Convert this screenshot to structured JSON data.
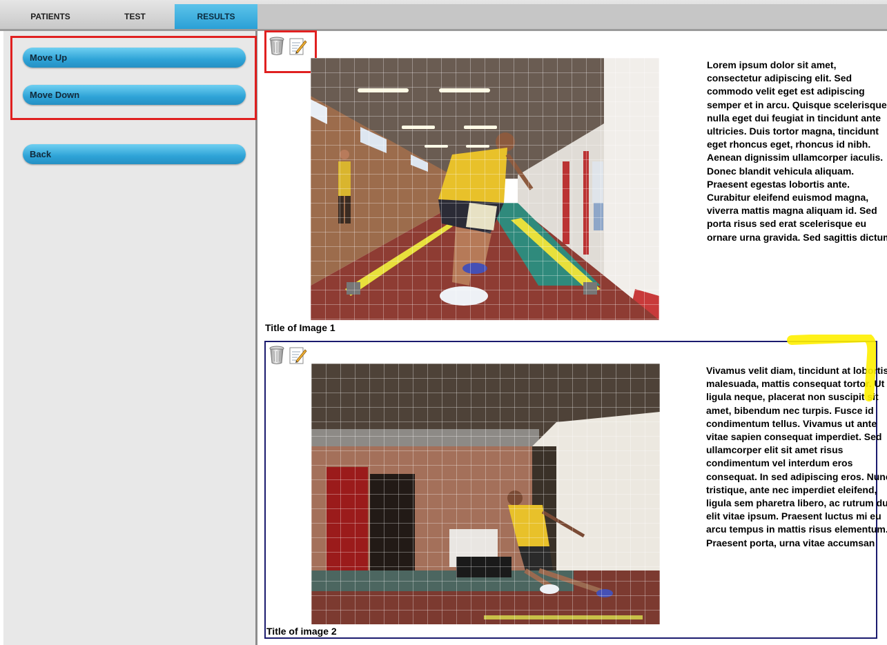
{
  "tabs": [
    {
      "label": "PATIENTS"
    },
    {
      "label": "TEST"
    },
    {
      "label": "RESULTS"
    }
  ],
  "active_tab": "RESULTS",
  "sidebar": {
    "move_up": "Move Up",
    "move_down": "Move Down",
    "back": "Back"
  },
  "results": [
    {
      "caption": "Title of Image 1",
      "text": "Lorem ipsum dolor sit amet, consectetur adipiscing elit. Sed commodo velit eget est adipiscing semper et in arcu. Quisque scelerisque nulla eget dui feugiat in tincidunt ante ultricies. Duis tortor magna, tincidunt eget rhoncus eget, rhoncus id nibh. Aenean dignissim ullamcorper iaculis. Donec blandit vehicula aliquam. Praesent egestas lobortis ante. Curabitur eleifend euismod magna, viverra mattis magna aliquam id. Sed porta risus sed erat scelerisque eu ornare urna gravida. Sed sagittis dictum"
    },
    {
      "caption": "Title of image 2",
      "text": "Vivamus velit diam, tincidunt at lobortis malesuada, mattis consequat tortor. Ut ligula neque, placerat non suscipit sit amet, bibendum nec turpis. Fusce id condimentum tellus. Vivamus ut ante vitae sapien consequat imperdiet. Sed ullamcorper elit sit amet risus condimentum vel interdum eros consequat. In sed adipiscing eros. Nunc tristique, ante nec imperdiet eleifend, ligula sem pharetra libero, ac rutrum dui elit vitae ipsum. Praesent luctus mi eu arcu tempus in mattis risus elementum. Praesent porta, urna vitae accumsan"
    }
  ],
  "icons": {
    "delete": "trash-icon",
    "edit": "edit-icon"
  },
  "colors": {
    "accent": "#2ea3d7",
    "highlight": "#e02020",
    "marker": "#ffee00",
    "selected_border": "#1a1a6e"
  }
}
